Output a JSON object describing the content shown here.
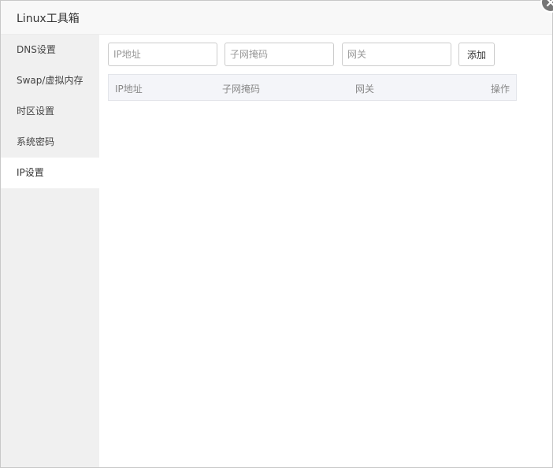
{
  "window": {
    "title": "Linux工具箱"
  },
  "sidebar": {
    "items": [
      {
        "label": "DNS设置"
      },
      {
        "label": "Swap/虚拟内存"
      },
      {
        "label": "时区设置"
      },
      {
        "label": "系统密码"
      },
      {
        "label": "IP设置"
      }
    ],
    "active_index": 4
  },
  "form": {
    "ip_placeholder": "IP地址",
    "mask_placeholder": "子网掩码",
    "gateway_placeholder": "网关",
    "add_label": "添加"
  },
  "table": {
    "columns": [
      "IP地址",
      "子网掩码",
      "网关",
      "操作"
    ],
    "rows": []
  },
  "icons": {
    "close": "close-icon"
  }
}
